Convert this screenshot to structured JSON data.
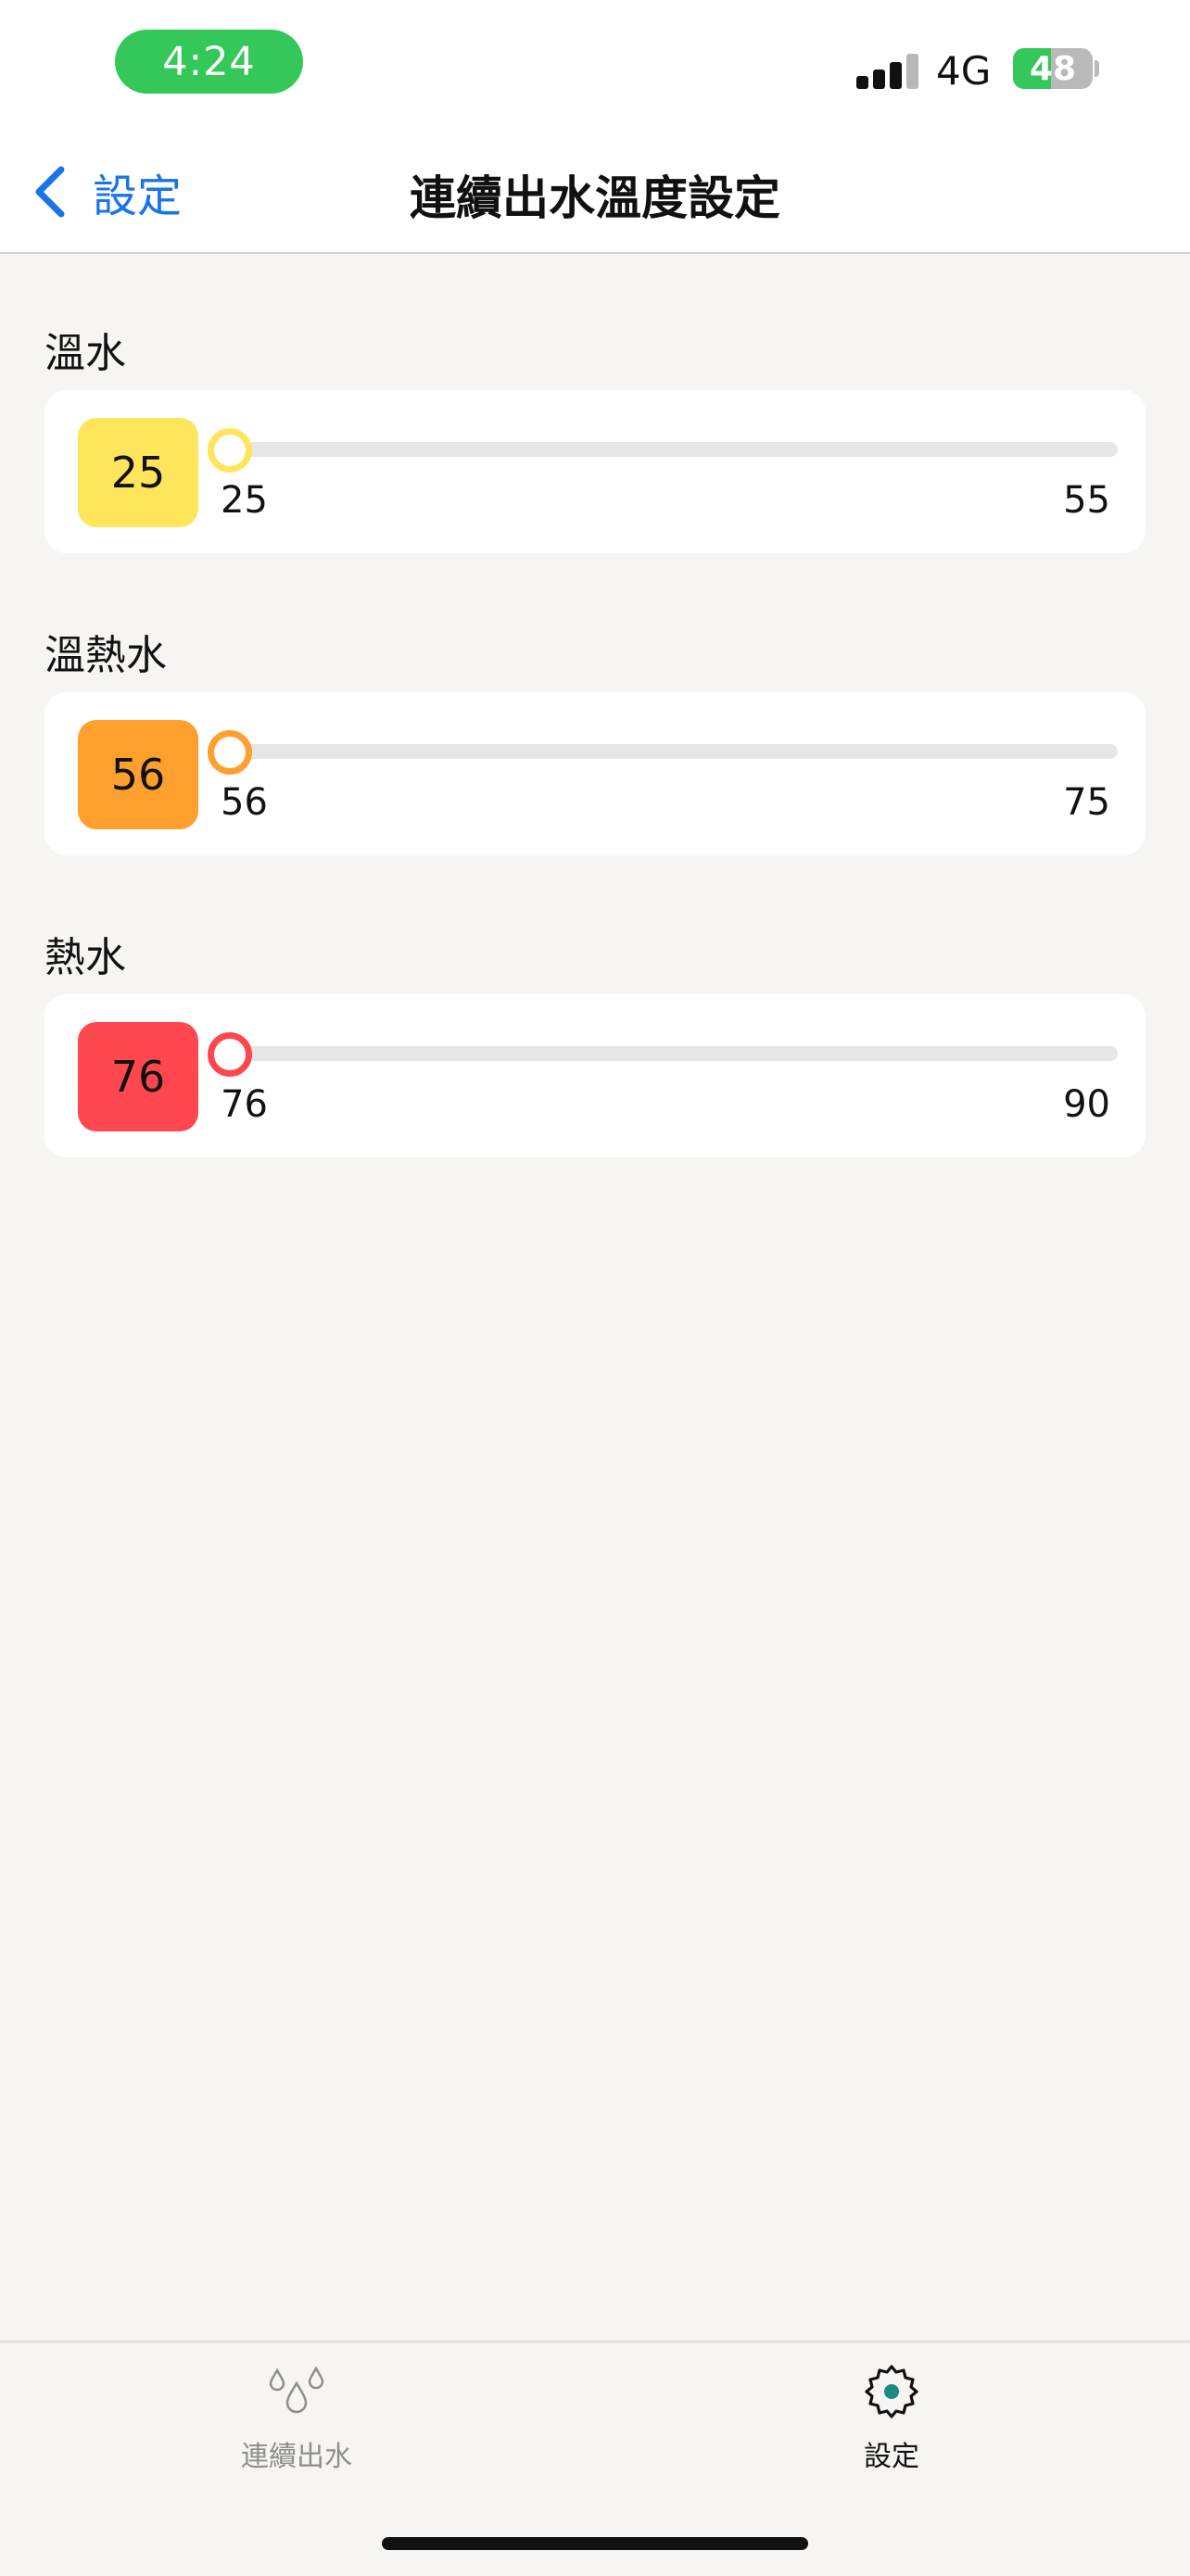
{
  "status_bar": {
    "time": "4:24",
    "network": "4G",
    "battery_level": "48",
    "signal_icon": "cellular-signal-icon",
    "battery_icon": "battery-charging-icon"
  },
  "nav": {
    "back_label": "設定",
    "back_icon": "chevron-left-icon",
    "title": "連續出水溫度設定"
  },
  "sections": [
    {
      "title": "溫水",
      "value": "25",
      "min": "25",
      "max": "55",
      "color": "#ffe55c",
      "knob_color": "#ffe55c",
      "position": 0.0
    },
    {
      "title": "溫熱水",
      "value": "56",
      "min": "56",
      "max": "75",
      "color": "#ff9f2e",
      "knob_color": "#ff9f2e",
      "position": 0.0
    },
    {
      "title": "熱水",
      "value": "76",
      "min": "76",
      "max": "90",
      "color": "#ff474f",
      "knob_color": "#ff474f",
      "position": 0.0
    }
  ],
  "tabbar": {
    "tabs": [
      {
        "label": "連續出水",
        "icon": "water-drops-icon",
        "color": "#8e8e8e",
        "active": false
      },
      {
        "label": "設定",
        "icon": "gear-icon",
        "color": "#111111",
        "active": true
      }
    ]
  },
  "colors": {
    "accent": "#1a73e8",
    "status_green": "#34c759",
    "active_tab_dot": "#1a8a83"
  }
}
